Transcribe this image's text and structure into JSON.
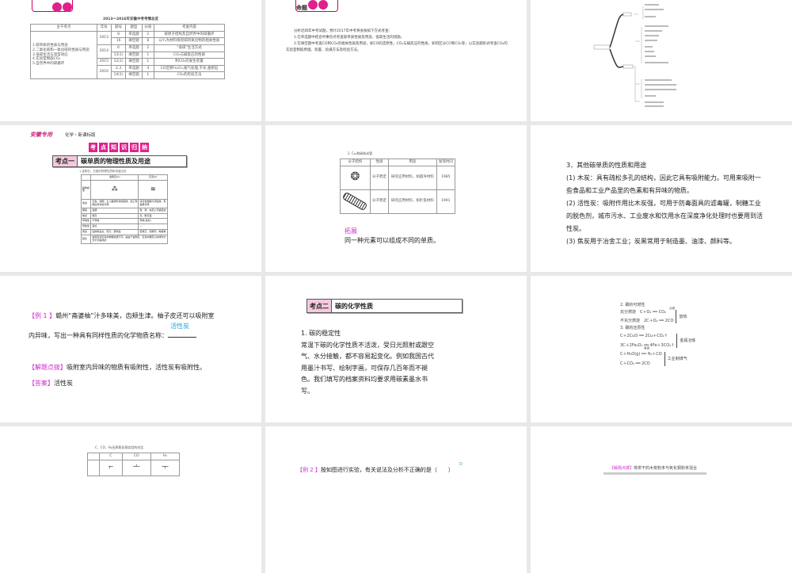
{
  "slides": {
    "s1": {
      "title": "2013～2016年安徽中考考情总览",
      "headers": [
        "主干考点",
        "年份",
        "题号",
        "题型",
        "分值",
        "考查内容"
      ],
      "topics": [
        "1.碳单质的性质与用途",
        "2.二氧化碳和一氧化碳的性质与用途",
        "3.低碳生活与温室效应",
        "4.实验室制取CO₂",
        "5.自然界中的碳循环"
      ],
      "rows": [
        {
          "year": "2013",
          "no": "8",
          "type": "单选题",
          "score": "2",
          "content": "碳原子结构及自然界中的碳循环"
        },
        {
          "year": "",
          "no": "16",
          "type": "填空题",
          "score": "8",
          "content": "以Y₂为材料探究碳的氧化物的相关性质"
        },
        {
          "year": "2014",
          "no": "6",
          "type": "单选题",
          "score": "2",
          "content": "“低碳”生活方式"
        },
        {
          "year": "",
          "no": "13(1)",
          "type": "填空题",
          "score": "1",
          "content": "CO₂与碱反应的性质"
        },
        {
          "year": "2015",
          "no": "12(1)",
          "type": "填空题",
          "score": "1",
          "content": "制CO₂的发生装置"
        },
        {
          "year": "2016",
          "no": "2,3",
          "type": "单选题",
          "score": "4",
          "content": "CO还原Fe₂O₃,尾气处理,干冰,金刚石"
        },
        {
          "year": "",
          "no": "14(1)",
          "type": "填空题",
          "score": "1",
          "content": "CO₂的检验方法"
        }
      ]
    },
    "s2": {
      "badge": "命题",
      "lines": [
        "分析近四年中考试题，预计2017年中考将会按如下方式考查：",
        "1.在单选题中结合时事热点考查碳单质性质及用途，低碳生活的措施。",
        "2.在填空题中考查CO和CO₂的相关性质及用途，如CO的还原性，CO₂与碱反应的性质，如何区分CO和CO₂等；以实验题形式考查CO₂的实验室制取原理、装置、验满方法及检验方法。"
      ]
    },
    "s4": {
      "brand": "安徽专用",
      "subject": "化学・新课标版",
      "banner": [
        "考",
        "点",
        "知",
        "识",
        "归",
        "纳"
      ],
      "kd_label": "考点一",
      "kd_title": "碳单质的物理性质及用途",
      "table_title": "1.金刚石、石墨的物理性质和用途比较",
      "headers": [
        "",
        "金刚石(C)",
        "石墨(C)"
      ],
      "rows": [
        [
          "结构模型",
          "",
          ""
        ],
        [
          "色态",
          "无色、透明、正八面体形状的固体，加工琢磨后有夺目光泽",
          "深灰色细鳞片状固体，有金属光泽"
        ],
        [
          "硬度",
          "最硬",
          "软、滑，在纸上可留痕迹"
        ],
        [
          "熔点",
          "很高",
          "高，耐高温"
        ],
        [
          "导电性",
          "不导电",
          "导电(良好)"
        ],
        [
          "导热性",
          "良好",
          "—"
        ],
        [
          "用途",
          "钻探机钻头、刻刀、装饰品",
          "铅笔芯、润滑剂、电极等"
        ]
      ],
      "conclusion_label": "结论",
      "conclusion": "金刚石和石墨的物理性质不同，是由于金刚石、石墨中碳原子的排列方式不同造成的"
    },
    "s5": {
      "table_title": "2. C₆₀和碳纳米管",
      "headers": [
        "分子结构",
        "性质",
        "用途",
        "发现时间"
      ],
      "rows": [
        {
          "prop": "分子稳定",
          "use": "研究应用材料，如超导材料",
          "year": "1985"
        },
        {
          "prop": "分子稳定",
          "use": "研究应用材料，如贮氢材料",
          "year": "1991"
        }
      ],
      "ext_title": "拓展",
      "ext_text": "同一种元素可以组成不同的单质。"
    },
    "s6": {
      "title": "3．其他碳单质的性质和用途",
      "p1": "(1) 木炭：具有疏松多孔的结构，因此它具有吸附能力。可用来吸附一些食品和工业产品里的色素和有异味的物质。",
      "p2": "(2) 活性炭：吸附作用比木炭强，可用于防毒面具的滤毒罐，制糖工业的脱色剂，城市污水、工业废水和饮用水在深度净化处理时也要用到活性炭。",
      "p3": "(3) 焦炭用于冶金工业；炭黑常用于制造墨、油漆、颜料等。"
    },
    "s7": {
      "ex_label": "【例 1 】",
      "ex_text1": "赣州“斋婆柚”汁多味美，齿颊生津。柚子皮还可以吸附室",
      "ex_text2": "内异味，写出一种具有同样性质的化学物质名称：",
      "blank_answer": "活性炭",
      "tip_label": "【解题点拨】",
      "tip_text": "吸附室内异味的物质有吸附性，活性炭有吸附性。",
      "ans_label": "【答案】",
      "ans_text": "活性炭"
    },
    "s8": {
      "kd_label": "考点二",
      "kd_title": "碳的化学性质",
      "heading": "1. 碳的稳定性",
      "body": "常温下碳的化学性质不活泼，受日光照射或跟空气、水分接触，都不容易起变化。例如我国古代用墨汁书写、绘制字画，可保存几百年而不褪色。我们填写的档案资料均要求用碳素墨水书写。"
    },
    "s9": {
      "h2": "2. 碳的可燃性",
      "c1": "充分燃烧　C＋O₂ ══ CO₂",
      "c2": "不充分燃烧　2C＋O₂ ══ 2CO",
      "cond1": "点燃",
      "brace1": "放热",
      "h3": "3. 碳的还原性",
      "r1": "C＋2CuO ══ 2Cu＋CO₂↑",
      "r2": "3C＋2Fe₂O₃ ══ 4Fe＋3CO₂↑",
      "brace2": "金属冶炼",
      "r3": "C＋H₂O(g) ══ H₂＋CO",
      "r4": "C＋CO₂ ══ 2CO",
      "cond2": "高温",
      "brace3": "工业制煤气"
    },
    "s10": {
      "title": "C、CO、H₂还原氧化铜实验的对比",
      "headers": [
        "",
        "C",
        "CO",
        "H₂"
      ]
    },
    "s11": {
      "ex_label": "【例 2 】",
      "ex_text": "按如图进行实验，有关说法及分析不正确的是（　　）",
      "answer": "D"
    },
    "s12": {
      "tip_label": "【解题点拨】",
      "tip_text": "将烘干的木炭粉末与氧化铜粉末混合"
    }
  }
}
